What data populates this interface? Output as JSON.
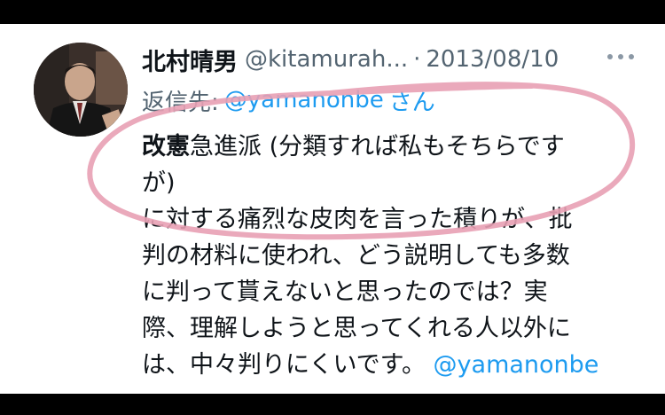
{
  "tweet": {
    "author_name": "北村晴男",
    "author_handle": "@kitamurah...",
    "separator": "·",
    "date": "2013/08/10",
    "more_icon": "ellipsis-icon",
    "reply_label": "返信先:",
    "reply_user": "@yamanonbe",
    "reply_suffix": "さん",
    "body_lines": [
      {
        "bold": "改憲",
        "text": "急進派 (分類すれば私もそちらです"
      },
      {
        "text": "が)"
      },
      {
        "text": "に対する痛烈な皮肉を言った積りが、批"
      },
      {
        "text": "判の材料に使われ、どう説明しても多数"
      },
      {
        "text": "に判って貰えないと思ったのでは？実"
      },
      {
        "text": "際、理解しようと思ってくれる人以外に"
      },
      {
        "text": "は、中々判りにくいです。",
        "mention": "@yamanonbe"
      }
    ]
  },
  "colors": {
    "text_primary": "#0f1419",
    "text_secondary": "#536471",
    "link": "#1d9bf0",
    "annotation_stroke": "#e8a0b4"
  }
}
